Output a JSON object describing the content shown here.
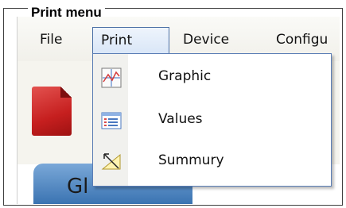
{
  "frame": {
    "title": "Print menu"
  },
  "menubar": {
    "items": [
      {
        "label": "File"
      },
      {
        "label": "Print"
      },
      {
        "label": "Device"
      },
      {
        "label": "Configu"
      }
    ]
  },
  "tab": {
    "label": "Gl"
  },
  "print_menu": {
    "items": [
      {
        "label": "Graphic",
        "icon": "graph-icon"
      },
      {
        "label": "Values",
        "icon": "list-icon"
      },
      {
        "label": "Summury",
        "icon": "summary-icon"
      }
    ]
  }
}
